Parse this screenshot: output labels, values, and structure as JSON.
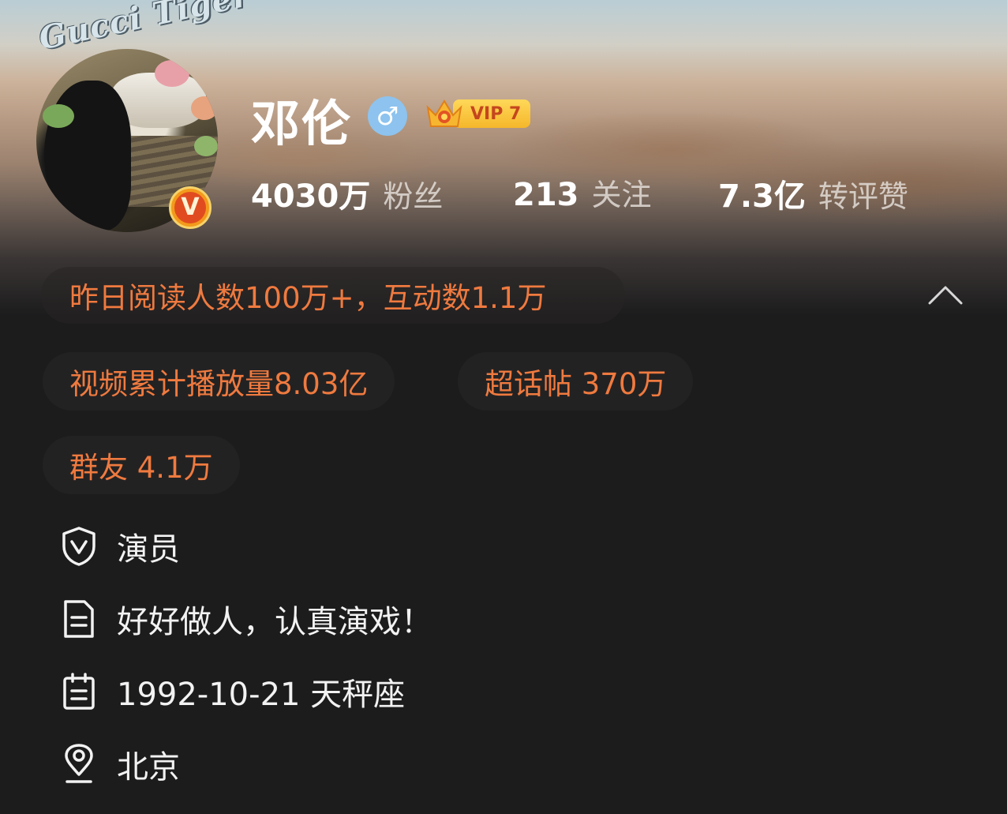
{
  "profile": {
    "name": "邓伦",
    "gender_icon": "male-icon",
    "gender_symbol": "♂",
    "vip_label": "VIP 7",
    "avatar_text": "Gucci Tiger",
    "verified_symbol": "V",
    "accent_color": "#ef7a3f"
  },
  "stats": [
    {
      "value": "4030万",
      "label": "粉丝"
    },
    {
      "value": "213",
      "label": "关注"
    },
    {
      "value": "7.3亿",
      "label": "转评赞"
    }
  ],
  "reads_summary": "昨日阅读人数100万+，互动数1.1万",
  "tags": [
    {
      "text": "视频累计播放量8.03亿"
    },
    {
      "text": "超话帖 370万"
    },
    {
      "text": "群友 4.1万"
    }
  ],
  "info": [
    {
      "icon": "shield-v-icon",
      "text": "演员"
    },
    {
      "icon": "document-icon",
      "text": "好好做人，认真演戏！"
    },
    {
      "icon": "calendar-icon",
      "text": "1992-10-21 天秤座"
    },
    {
      "icon": "location-pin-icon",
      "text": "北京"
    }
  ]
}
